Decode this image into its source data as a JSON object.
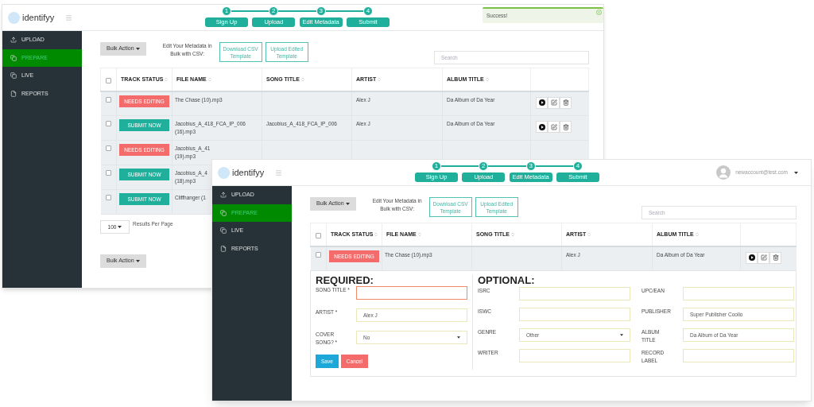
{
  "back_window": {
    "logo": "identifyy",
    "steps": [
      {
        "number": "1",
        "label": "Sign Up"
      },
      {
        "number": "2",
        "label": "Upload"
      },
      {
        "number": "3",
        "label": "Edit Metadata"
      },
      {
        "number": "4",
        "label": "Submit"
      }
    ],
    "notification": {
      "text": "Success!"
    },
    "sidebar": [
      {
        "label": "UPLOAD",
        "selected": false
      },
      {
        "label": "PREPARE",
        "selected": true
      },
      {
        "label": "LIVE",
        "selected": false
      },
      {
        "label": "REPORTS",
        "selected": false
      }
    ],
    "bulk_action": "Bulk Action",
    "csv_label": "Edit Your Metadata in Bulk with CSV:",
    "csv_buttons": [
      "Download CSV Template",
      "Upload Edited Template"
    ],
    "search": {
      "placeholder": "Search"
    },
    "select_all_checked": false,
    "columns": [
      "TRACK STATUS",
      "FILE NAME",
      "SONG TITLE",
      "ARTIST",
      "ALBUM TITLE"
    ],
    "rows": [
      {
        "checked": false,
        "status": {
          "kind": "needs_editing",
          "label": "NEEDS EDITING"
        },
        "file_name": "The Chase (10).mp3",
        "artist": "Alex J",
        "album_title": "Da Album of Da Year"
      },
      {
        "checked": false,
        "status": {
          "kind": "submit",
          "label": "SUBMIT NOW"
        },
        "file_name": "Jacobius_A_418_FCA_IP_006 (16).mp3",
        "song_title": "Jacobius_A_418_FCA_IP_006",
        "artist": "Alex J",
        "album_title": "Da Album of Da Year"
      },
      {
        "checked": false,
        "status": {
          "kind": "needs_editing",
          "label": "NEEDS EDITING"
        },
        "file_name": "Jacobius_A_41\n(19).mp3"
      },
      {
        "checked": false,
        "status": {
          "kind": "submit",
          "label": "SUBMIT NOW"
        },
        "file_name": "Jacobius_A_4\n(18).mp3"
      },
      {
        "checked": false,
        "status": {
          "kind": "submit",
          "label": "SUBMIT NOW"
        },
        "file_name": "Cliffhanger (1"
      }
    ],
    "per_page": {
      "value": "100",
      "label": "Results Per Page"
    },
    "bottom_bulk_action": "Bulk Action"
  },
  "front_window": {
    "logo": "identifyy",
    "steps": [
      {
        "number": "1",
        "label": "Sign Up"
      },
      {
        "number": "2",
        "label": "Upload"
      },
      {
        "number": "3",
        "label": "Edit Metadata"
      },
      {
        "number": "4",
        "label": "Submit"
      }
    ],
    "user_email": "newaccount@test.com",
    "sidebar": [
      {
        "label": "UPLOAD",
        "selected": false
      },
      {
        "label": "PREPARE",
        "selected": true
      },
      {
        "label": "LIVE",
        "selected": false
      },
      {
        "label": "REPORTS",
        "selected": false
      }
    ],
    "bulk_action": "Bulk Action",
    "csv_label": "Edit Your Metadata in Bulk with CSV:",
    "csv_buttons": [
      "Download CSV Template",
      "Upload Edited Template"
    ],
    "search": {
      "placeholder": "Search"
    },
    "select_all_checked": false,
    "columns": [
      "TRACK STATUS",
      "FILE NAME",
      "SONG TITLE",
      "ARTIST",
      "ALBUM TITLE"
    ],
    "rows": [
      {
        "checked": false,
        "status": {
          "kind": "needs_editing",
          "label": "NEEDS EDITING"
        },
        "file_name": "The Chase (10).mp3",
        "artist": "Alex J",
        "album_title": "Da Album of Da Year"
      }
    ],
    "form": {
      "required_title": "REQUIRED:",
      "required_fields": [
        {
          "label": "SONG TITLE *",
          "kind": "text",
          "invalid": true
        },
        {
          "label": "ARTIST *",
          "kind": "text",
          "value": "Alex J",
          "invalid": false
        },
        {
          "label": "COVER SONG? *",
          "kind": "select",
          "value": "No",
          "invalid": false
        }
      ],
      "buttons": [
        {
          "label": "Save",
          "kind": "primary"
        },
        {
          "label": "Cancel",
          "kind": "danger"
        }
      ],
      "optional_title": "OPTIONAL:",
      "optional_columns": [
        [
          {
            "label": "ISRC",
            "kind": "text"
          },
          {
            "label": "ISWC",
            "kind": "text"
          },
          {
            "label": "GENRE",
            "kind": "select",
            "value": "Other"
          },
          {
            "label": "WRITER",
            "kind": "text"
          }
        ],
        [
          {
            "label": "UPC/EAN",
            "kind": "text"
          },
          {
            "label": "PUBLISHER",
            "kind": "text",
            "value": "Super Publisher Coolio"
          },
          {
            "label": "ALBUM TITLE",
            "kind": "text",
            "value": "Da Album of Da Year"
          },
          {
            "label": "RECORD LABEL",
            "kind": "text"
          }
        ]
      ]
    }
  }
}
